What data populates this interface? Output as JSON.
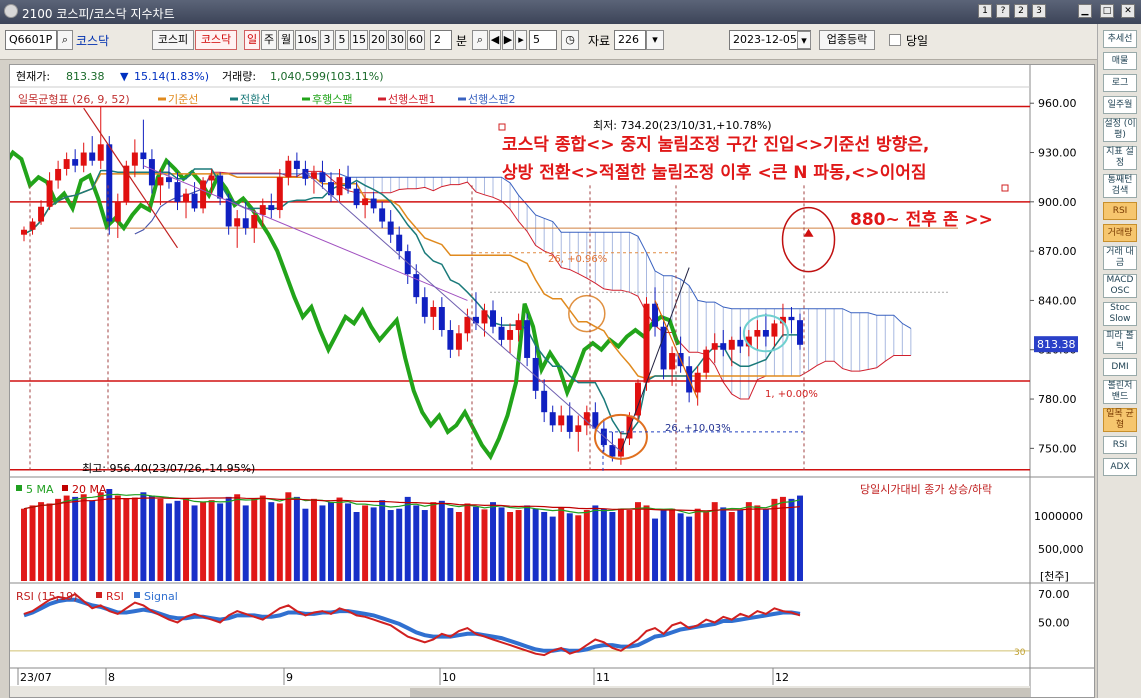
{
  "window": {
    "title": "2100 코스피/코스닥 지수차트",
    "btn_help": "?",
    "btn_1": "1",
    "btn_2": "2",
    "btn_3": "3"
  },
  "toolbar": {
    "code": "Q6601P",
    "market_name": "코스닥",
    "btn_kospi": "코스피",
    "btn_kosdaq": "코스닥",
    "periods": [
      "일",
      "주",
      "월",
      "10s",
      "3",
      "5",
      "15",
      "20",
      "30",
      "60"
    ],
    "minute_value": "2",
    "minute_label": "분",
    "step_value": "5",
    "data_label": "자료",
    "data_value": "226",
    "date": "2023-12-05",
    "sector_btn": "업종등락",
    "today_label": "당일"
  },
  "header": {
    "price_label": "현재가:",
    "price": "813.38",
    "change_arrow": "▼",
    "change": "15.14(1.83%)",
    "volume_label": "거래량:",
    "volume": "1,040,599(103.11%)"
  },
  "legend": {
    "name": "일목균형표 (26, 9, 52)",
    "items": [
      {
        "label": "기준선",
        "color": "#e08a1e"
      },
      {
        "label": "전환선",
        "color": "#1a7a7a"
      },
      {
        "label": "후행스팬",
        "color": "#22a41a"
      },
      {
        "label": "선행스팬1",
        "color": "#d0202e"
      },
      {
        "label": "선행스팬2",
        "color": "#3a62c0"
      }
    ]
  },
  "chart_data": [
    {
      "type": "candlestick",
      "title": "",
      "y_ticks": [
        "960.00",
        "930.00",
        "900.00",
        "870.00",
        "840.00",
        "810.00",
        "780.00",
        "750.00"
      ],
      "ylim": [
        735,
        965
      ],
      "current_price_tag": "813.38",
      "x_labels": [
        "23/07",
        "8",
        "9",
        "10",
        "11",
        "12"
      ],
      "candles": [
        [
          880,
          885,
          876,
          883
        ],
        [
          883,
          890,
          880,
          888
        ],
        [
          888,
          901,
          886,
          897
        ],
        [
          897,
          918,
          895,
          913
        ],
        [
          913,
          925,
          908,
          920
        ],
        [
          920,
          930,
          916,
          926
        ],
        [
          926,
          932,
          918,
          922
        ],
        [
          922,
          936,
          918,
          930
        ],
        [
          930,
          940,
          922,
          925
        ],
        [
          925,
          958,
          920,
          935
        ],
        [
          935,
          940,
          880,
          888
        ],
        [
          888,
          905,
          878,
          900
        ],
        [
          900,
          925,
          898,
          922
        ],
        [
          922,
          938,
          915,
          930
        ],
        [
          930,
          950,
          920,
          926
        ],
        [
          926,
          932,
          905,
          910
        ],
        [
          910,
          920,
          898,
          915
        ],
        [
          915,
          925,
          908,
          912
        ],
        [
          912,
          918,
          895,
          900
        ],
        [
          900,
          908,
          890,
          905
        ],
        [
          905,
          912,
          894,
          896
        ],
        [
          896,
          915,
          893,
          913
        ],
        [
          913,
          920,
          905,
          916
        ],
        [
          916,
          918,
          898,
          902
        ],
        [
          902,
          905,
          880,
          885
        ],
        [
          885,
          895,
          872,
          890
        ],
        [
          890,
          900,
          880,
          884
        ],
        [
          884,
          895,
          875,
          892
        ],
        [
          892,
          902,
          885,
          898
        ],
        [
          898,
          905,
          890,
          895
        ],
        [
          895,
          920,
          890,
          915
        ],
        [
          915,
          928,
          910,
          925
        ],
        [
          925,
          930,
          915,
          920
        ],
        [
          920,
          925,
          910,
          914
        ],
        [
          914,
          922,
          905,
          918
        ],
        [
          918,
          925,
          908,
          912
        ],
        [
          912,
          918,
          900,
          904
        ],
        [
          904,
          920,
          900,
          915
        ],
        [
          915,
          922,
          905,
          908
        ],
        [
          908,
          912,
          896,
          898
        ],
        [
          898,
          905,
          890,
          902
        ],
        [
          902,
          906,
          893,
          896
        ],
        [
          896,
          900,
          884,
          888
        ],
        [
          888,
          895,
          875,
          880
        ],
        [
          880,
          885,
          865,
          870
        ],
        [
          870,
          874,
          850,
          856
        ],
        [
          856,
          862,
          838,
          842
        ],
        [
          842,
          848,
          826,
          830
        ],
        [
          830,
          840,
          822,
          836
        ],
        [
          836,
          842,
          818,
          822
        ],
        [
          822,
          828,
          805,
          810
        ],
        [
          810,
          825,
          806,
          820
        ],
        [
          820,
          835,
          815,
          830
        ],
        [
          830,
          845,
          822,
          826
        ],
        [
          826,
          838,
          818,
          834
        ],
        [
          834,
          840,
          820,
          824
        ],
        [
          824,
          830,
          812,
          816
        ],
        [
          816,
          826,
          808,
          822
        ],
        [
          822,
          832,
          815,
          828
        ],
        [
          828,
          832,
          800,
          805
        ],
        [
          805,
          812,
          780,
          785
        ],
        [
          785,
          792,
          766,
          772
        ],
        [
          772,
          776,
          760,
          764
        ],
        [
          764,
          776,
          760,
          770
        ],
        [
          770,
          778,
          756,
          760
        ],
        [
          760,
          770,
          748,
          764
        ],
        [
          764,
          776,
          758,
          772
        ],
        [
          772,
          778,
          758,
          762
        ],
        [
          762,
          768,
          748,
          752
        ],
        [
          752,
          760,
          742,
          745
        ],
        [
          745,
          760,
          740,
          756
        ],
        [
          756,
          772,
          752,
          770
        ],
        [
          770,
          792,
          766,
          790
        ],
        [
          790,
          842,
          785,
          838
        ],
        [
          838,
          848,
          818,
          824
        ],
        [
          824,
          830,
          792,
          798
        ],
        [
          798,
          812,
          788,
          808
        ],
        [
          808,
          818,
          796,
          800
        ],
        [
          800,
          806,
          778,
          784
        ],
        [
          784,
          800,
          776,
          796
        ],
        [
          796,
          812,
          792,
          810
        ],
        [
          810,
          820,
          802,
          814
        ],
        [
          814,
          822,
          806,
          810
        ],
        [
          810,
          818,
          800,
          816
        ],
        [
          816,
          824,
          808,
          812
        ],
        [
          812,
          822,
          806,
          818
        ],
        [
          818,
          828,
          810,
          822
        ],
        [
          822,
          832,
          812,
          818
        ],
        [
          818,
          828,
          812,
          826
        ],
        [
          826,
          838,
          818,
          830
        ],
        [
          830,
          836,
          820,
          828
        ],
        [
          828,
          832,
          810,
          813
        ]
      ],
      "annotations": [
        {
          "text": "최저: 734.20(23/10/31,+10.78%)",
          "kind": "low"
        },
        {
          "text": "최고: 956.40(23/07/26,-14.95%)",
          "kind": "high"
        },
        {
          "text": "26, +0.96%",
          "kind": "measure"
        },
        {
          "text": "26, +10.03%",
          "kind": "measure"
        },
        {
          "text": "1, +0.00%",
          "kind": "measure"
        },
        {
          "text": "코스닥 종합<> 중지 눌림조정 구간 진입<>기준선 방향은,",
          "kind": "comment"
        },
        {
          "text": "상방 전환<>적절한 눌림조정 이후 <큰 N 파동,<>이어짐",
          "kind": "comment"
        },
        {
          "text": "880~ 전후 존 >>",
          "kind": "comment"
        }
      ],
      "horizontal_lines": [
        {
          "value": 958,
          "color": "#d01010"
        },
        {
          "value": 900,
          "color": "#d01010"
        },
        {
          "value": 791,
          "color": "#d01010"
        },
        {
          "value": 737,
          "color": "#d01010"
        }
      ]
    },
    {
      "type": "bar",
      "title": "당일시가대비 종가 상승/하락",
      "series": [
        {
          "name": "5 MA",
          "color": "#20a020"
        },
        {
          "name": "20 MA",
          "color": "#c00000"
        }
      ],
      "y_ticks": [
        "1000000",
        "500,000"
      ],
      "unit": "[천주]",
      "ylim": [
        0,
        1400000
      ],
      "volumes": [
        1100000,
        1150000,
        1200000,
        1180000,
        1250000,
        1300000,
        1280000,
        1320000,
        1220000,
        1350000,
        1400000,
        1300000,
        1250000,
        1270000,
        1350000,
        1300000,
        1250000,
        1180000,
        1220000,
        1260000,
        1150000,
        1200000,
        1230000,
        1180000,
        1280000,
        1320000,
        1150000,
        1250000,
        1300000,
        1200000,
        1180000,
        1350000,
        1280000,
        1100000,
        1250000,
        1150000,
        1200000,
        1270000,
        1180000,
        1050000,
        1150000,
        1120000,
        1230000,
        1080000,
        1100000,
        1280000,
        1150000,
        1080000,
        1200000,
        1220000,
        1110000,
        1050000,
        1180000,
        1130000,
        1090000,
        1200000,
        1120000,
        1050000,
        1080000,
        1150000,
        1100000,
        1050000,
        980000,
        1120000,
        1030000,
        1000000,
        1080000,
        1150000,
        1100000,
        1050000,
        1100000,
        1080000,
        1200000,
        1150000,
        950000,
        1080000,
        1100000,
        1030000,
        980000,
        1100000,
        1050000,
        1200000,
        1120000,
        1050000,
        1080000,
        1200000,
        1150000,
        1100000,
        1250000,
        1280000,
        1250000,
        1300000
      ]
    },
    {
      "type": "line",
      "title": "RSI (15,19)",
      "series": [
        {
          "name": "RSI",
          "color": "#d02020"
        },
        {
          "name": "Signal",
          "color": "#3070d0"
        }
      ],
      "y_ticks": [
        "70.00",
        "50.00",
        "30"
      ],
      "ylim": [
        20,
        75
      ],
      "rsi": [
        56,
        58,
        62,
        66,
        68,
        67,
        70,
        65,
        60,
        62,
        58,
        56,
        60,
        64,
        62,
        58,
        55,
        52,
        50,
        54,
        56,
        54,
        52,
        50,
        55,
        58,
        56,
        54,
        52,
        56,
        60,
        62,
        58,
        55,
        57,
        58,
        56,
        60,
        58,
        55,
        54,
        52,
        50,
        48,
        44,
        40,
        38,
        36,
        38,
        42,
        40,
        44,
        46,
        42,
        40,
        38,
        36,
        34,
        32,
        30,
        28,
        27,
        30,
        32,
        28,
        30,
        34,
        38,
        36,
        32,
        30,
        34,
        38,
        44,
        46,
        42,
        48,
        50,
        46,
        48,
        52,
        50,
        54,
        52,
        56,
        54,
        58,
        56,
        60,
        58,
        57,
        55
      ],
      "signal": [
        55,
        57,
        60,
        63,
        65,
        66,
        66,
        64,
        62,
        61,
        59,
        57,
        57,
        58,
        59,
        58,
        56,
        54,
        53,
        53,
        54,
        54,
        53,
        52,
        53,
        55,
        55,
        55,
        54,
        54,
        55,
        57,
        57,
        56,
        56,
        57,
        57,
        58,
        58,
        57,
        56,
        55,
        53,
        51,
        49,
        46,
        43,
        41,
        40,
        40,
        40,
        41,
        42,
        42,
        41,
        40,
        39,
        37,
        35,
        33,
        31,
        30,
        30,
        31,
        30,
        30,
        31,
        33,
        34,
        34,
        33,
        33,
        34,
        37,
        40,
        41,
        43,
        45,
        46,
        47,
        48,
        49,
        51,
        51,
        52,
        53,
        54,
        55,
        56,
        57,
        57,
        56
      ]
    }
  ],
  "sidebar": {
    "items": [
      "추세선",
      "매물",
      "로그",
      "일주월",
      "설정 (이평)",
      "지표 설정",
      "통째턴 검색",
      "RSI",
      "거래량",
      "거래 대금",
      "MACD OSC",
      "Stoc Slow",
      "피라 볼릭",
      "DMI",
      "볼린저 밴드",
      "일목 균형",
      "RSI",
      "ADX"
    ]
  }
}
